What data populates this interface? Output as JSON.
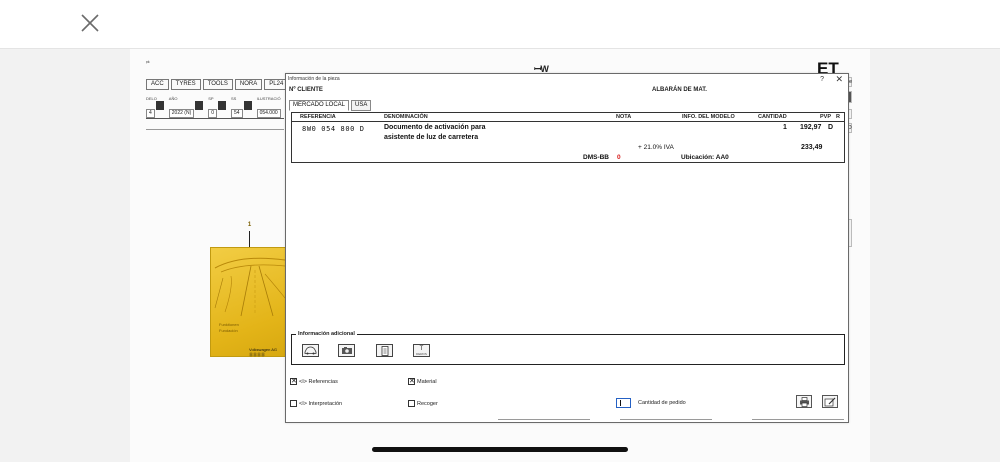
{
  "background_app": {
    "corner_text": "ᵖᵏ",
    "center_logo": "ꟷW",
    "right_logo": "ET",
    "tabs": [
      "ACC",
      "TYRES",
      "TOOLS",
      "NORA",
      "PL24"
    ],
    "fields": [
      {
        "label": "DELO",
        "value": "4"
      },
      {
        "label": "AÑO",
        "value": "2022 (N)"
      },
      {
        "label": "SP",
        "value": "0"
      },
      {
        "label": "SS",
        "value": "54"
      },
      {
        "label": "ILUSTRACIÓ",
        "value": "054.000"
      }
    ],
    "right_edge_letters": [
      "le",
      "D"
    ],
    "callout_number": "1",
    "manual": {
      "line1": "Funktionen",
      "line2": "Fundación",
      "brand": "Volkswagen AG ⓄⓄⓄⓄ"
    }
  },
  "dialog": {
    "title": "Información de la pieza",
    "help_label": "?",
    "close_label": "✕",
    "client_label": "Nº CLIENTE",
    "delivery_label": "ALBARÁN DE MAT.",
    "tabs": [
      "MERCADO LOCAL",
      "USA"
    ],
    "table": {
      "headers": [
        "REFERENCIA",
        "DENOMINACIÓN",
        "NOTA",
        "INFO. DEL MODELO",
        "CANTIDAD",
        "PVP",
        "R"
      ],
      "reference": "8W0 054 800 D",
      "description_line1": "Documento de activación para",
      "description_line2": "asistente de luz de carretera",
      "quantity": "1",
      "price": "192,97",
      "r": "D",
      "vat_label": "+ 21.0% IVA",
      "price_with_vat": "233,49",
      "dms_label": "DMS-BB",
      "dms_value": "0",
      "location": "Ubicación: AA0"
    },
    "info_box": {
      "label": "Información adicional",
      "icons": [
        "car-icon",
        "camera-icon",
        "document-icon",
        "info-t-icon"
      ],
      "t_icon_label": "T",
      "t_icon_sublabel": "DEROS"
    },
    "options": [
      {
        "label": "<I> Referencias",
        "checked": true
      },
      {
        "label": "Material",
        "checked": true
      },
      {
        "label": "<I> Interpretación",
        "checked": false
      },
      {
        "label": "Recoger",
        "checked": false
      }
    ],
    "quantity_label": "Cantidad de pedido",
    "check_mark": "✕"
  }
}
